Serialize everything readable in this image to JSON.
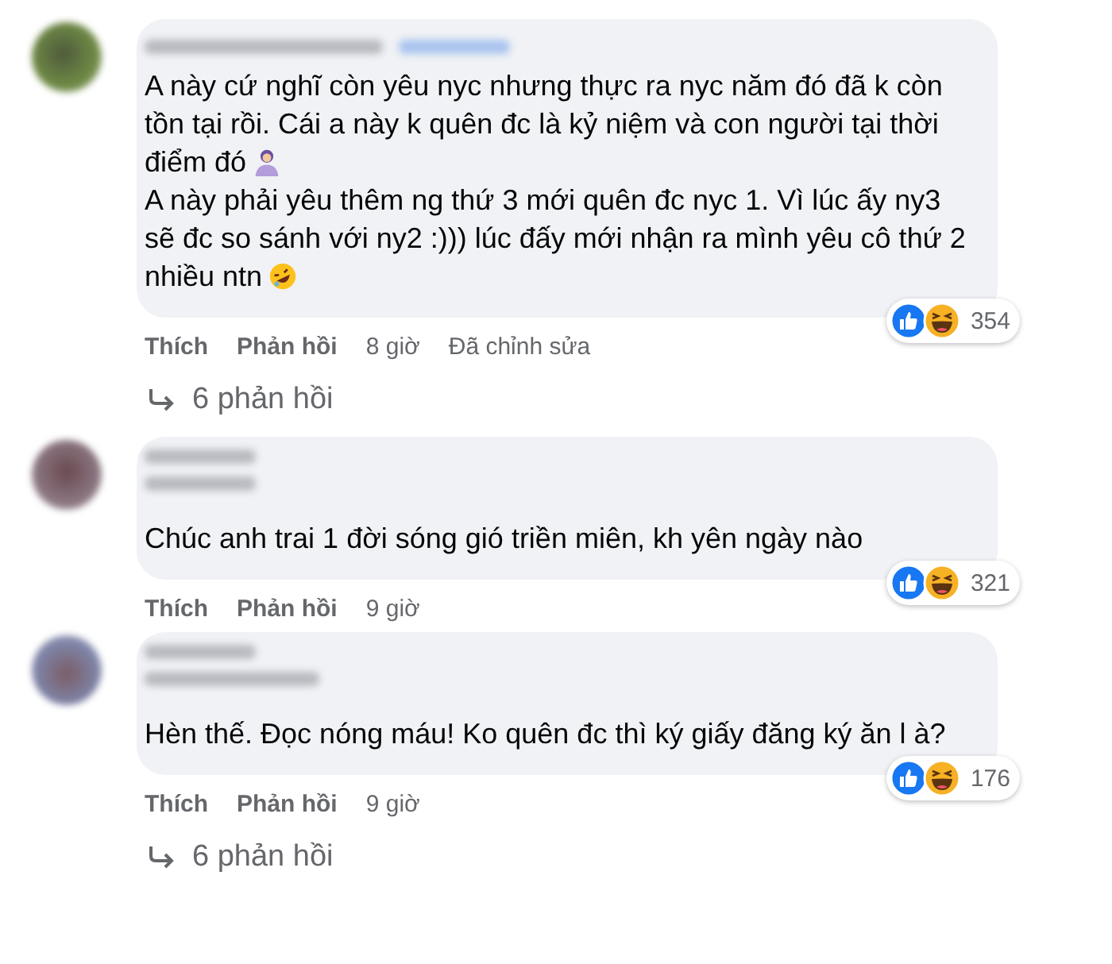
{
  "comments": [
    {
      "kind": "with_badge",
      "paragraphs": [
        {
          "text": "A này cứ nghĩ còn yêu nyc nhưng thực ra nyc năm đó đã k còn tồn tại rồi. Cái a này k quên đc là kỷ niệm và con người tại thời điểm đó",
          "icons": [
            {
              "kind": "person"
            }
          ]
        },
        {
          "text": "A này phải yêu thêm ng thứ 3 mới quên đc nyc 1. Vì lúc ấy ny3 sẽ đc so sánh với ny2 :))) lúc đấy mới nhận ra mình yêu cô thứ 2 nhiều ntn",
          "icons": [
            {
              "kind": "rofl"
            }
          ]
        }
      ],
      "reactions": {
        "icons": [
          {
            "kind": "like"
          },
          {
            "kind": "haha"
          }
        ],
        "count": "354"
      },
      "like_label": "Thích",
      "reply_label": "Phản hồi",
      "time": "8 giờ",
      "edited": "Đã chỉnh sửa",
      "replies": "6 phản hồi"
    },
    {
      "kind": "two_line",
      "paragraphs": [
        {
          "text": "Chúc anh trai 1 đời sóng gió triền miên, kh yên ngày nào"
        }
      ],
      "reactions": {
        "icons": [
          {
            "kind": "like"
          },
          {
            "kind": "haha"
          }
        ],
        "count": "321"
      },
      "like_label": "Thích",
      "reply_label": "Phản hồi",
      "time": "9 giờ"
    },
    {
      "kind": "two_line",
      "paragraphs": [
        {
          "text": "Hèn thế. Đọc nóng máu! Ko quên đc thì ký giấy đăng ký ăn l à?"
        }
      ],
      "reactions": {
        "icons": [
          {
            "kind": "like"
          },
          {
            "kind": "haha"
          }
        ],
        "count": "176"
      },
      "like_label": "Thích",
      "reply_label": "Phản hồi",
      "time": "9 giờ",
      "replies": "6 phản hồi"
    }
  ]
}
